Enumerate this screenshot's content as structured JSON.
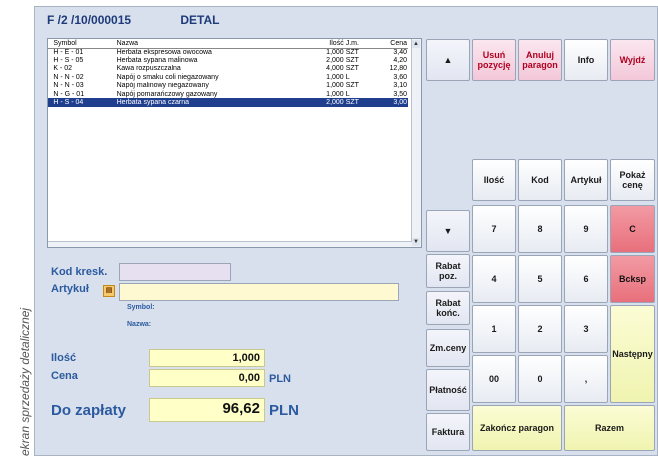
{
  "caption": "ekran sprzedaży detalicznej",
  "header": {
    "document": "F /2  /10/000015",
    "mode": "DETAL"
  },
  "table": {
    "columns": [
      "Symbol",
      "Nazwa",
      "Ilość",
      "J.m.",
      "Cena"
    ],
    "rows": [
      {
        "symbol": "H - E - 01",
        "nazwa": "Herbata ekspresowa owocowa",
        "ilosc": "1,000",
        "jm": "SZT",
        "cena": "3,40"
      },
      {
        "symbol": "H - S - 05",
        "nazwa": "Herbata sypana malinowa",
        "ilosc": "2,000",
        "jm": "SZT",
        "cena": "4,20"
      },
      {
        "symbol": "K - 02",
        "nazwa": "Kawa rozpuszczalna",
        "ilosc": "4,000",
        "jm": "SZT",
        "cena": "12,80"
      },
      {
        "symbol": "N - N - 02",
        "nazwa": "Napój o smaku coli niegazowany",
        "ilosc": "1,000",
        "jm": "L",
        "cena": "3,60"
      },
      {
        "symbol": "N - N - 03",
        "nazwa": "Napój malinowy niegazowany",
        "ilosc": "1,000",
        "jm": "SZT",
        "cena": "3,10"
      },
      {
        "symbol": "N - G - 01",
        "nazwa": "Napój pomarańczowy gazowany",
        "ilosc": "1,000",
        "jm": "L",
        "cena": "3,50"
      },
      {
        "symbol": "H - S - 04",
        "nazwa": "Herbata sypana czarna",
        "ilosc": "2,000",
        "jm": "SZT",
        "cena": "3,00"
      }
    ],
    "selected_row": 6
  },
  "form": {
    "kod_label": "Kod kresk.",
    "kod_value": "",
    "artykul_label": "Artykuł",
    "artykul_value": "",
    "symbol_label": "Symbol:",
    "nazwa_label": "Nazwa:",
    "ilosc_label": "Ilość",
    "ilosc_value": "1,000",
    "cena_label": "Cena",
    "cena_value": "0,00",
    "cena_currency": "PLN",
    "do_zaplaty_label": "Do zapłaty",
    "do_zaplaty_value": "96,62",
    "do_zaplaty_currency": "PLN"
  },
  "buttons": {
    "up_arrow": "▲",
    "down_arrow": "▼",
    "usun_pozycje": [
      "Usuń",
      "pozycję"
    ],
    "anuluj_paragon": [
      "Anuluj",
      "paragon"
    ],
    "info": "Info",
    "wyjdz": "Wyjdź",
    "ilosc": "Ilość",
    "kod": "Kod",
    "artykul": "Artykuł",
    "pokaz_cene": [
      "Pokaż",
      "cenę"
    ],
    "rabat_poz": [
      "Rabat",
      "poz."
    ],
    "rabat_konc": [
      "Rabat",
      "końc."
    ],
    "zm_ceny": "Zm.ceny",
    "platnosc": "Płatność",
    "faktura": "Faktura",
    "n7": "7",
    "n8": "8",
    "n9": "9",
    "c": "C",
    "n4": "4",
    "n5": "5",
    "n6": "6",
    "bcksp": "Bcksp",
    "n1": "1",
    "n2": "2",
    "n3": "3",
    "nastepny": "Następny",
    "n00": "00",
    "n0": "0",
    "dot": ",",
    "zakoncz_paragon": "Zakończ paragon",
    "razem": "Razem"
  },
  "colors": {
    "background": "#d7e0ec",
    "selected_row": "#1f3f8e",
    "label_blue": "#2c5aa0",
    "red_button": "#e8707c",
    "yellow_button": "#f0f4b0",
    "pink_button": "#f3c8d9"
  }
}
